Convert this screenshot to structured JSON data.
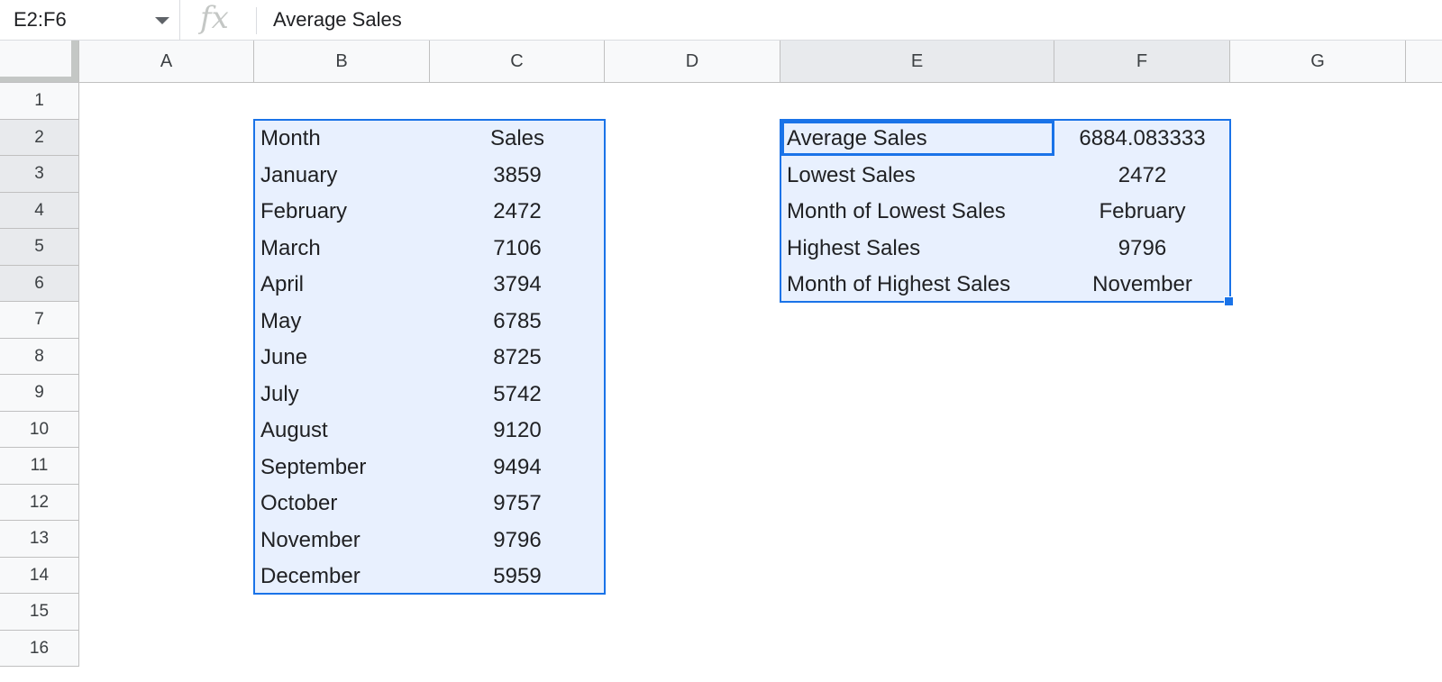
{
  "formula_bar": {
    "name_box": "E2:F6",
    "fx_label": "fx",
    "formula": "Average Sales"
  },
  "columns": [
    "A",
    "B",
    "C",
    "D",
    "E",
    "F",
    "G"
  ],
  "rows": [
    "1",
    "2",
    "3",
    "4",
    "5",
    "6",
    "7",
    "8",
    "9",
    "10",
    "11",
    "12",
    "13",
    "14",
    "15",
    "16"
  ],
  "sales_table": {
    "header": {
      "month": "Month",
      "sales": "Sales"
    },
    "rows": [
      {
        "month": "January",
        "sales": "3859"
      },
      {
        "month": "February",
        "sales": "2472"
      },
      {
        "month": "March",
        "sales": "7106"
      },
      {
        "month": "April",
        "sales": "3794"
      },
      {
        "month": "May",
        "sales": "6785"
      },
      {
        "month": "June",
        "sales": "8725"
      },
      {
        "month": "July",
        "sales": "5742"
      },
      {
        "month": "August",
        "sales": "9120"
      },
      {
        "month": "September",
        "sales": "9494"
      },
      {
        "month": "October",
        "sales": "9757"
      },
      {
        "month": "November",
        "sales": "9796"
      },
      {
        "month": "December",
        "sales": "5959"
      }
    ]
  },
  "summary_table": {
    "rows": [
      {
        "label": "Average Sales",
        "value": "6884.083333"
      },
      {
        "label": "Lowest Sales",
        "value": "2472"
      },
      {
        "label": "Month of Lowest Sales",
        "value": "February"
      },
      {
        "label": "Highest Sales",
        "value": "9796"
      },
      {
        "label": "Month of Highest Sales",
        "value": "November"
      }
    ]
  },
  "colors": {
    "selection_border": "#1a73e8",
    "selection_fill": "#e8f0fe",
    "header_bg": "#f8f9fa",
    "selected_header_bg": "#e8eaed"
  }
}
